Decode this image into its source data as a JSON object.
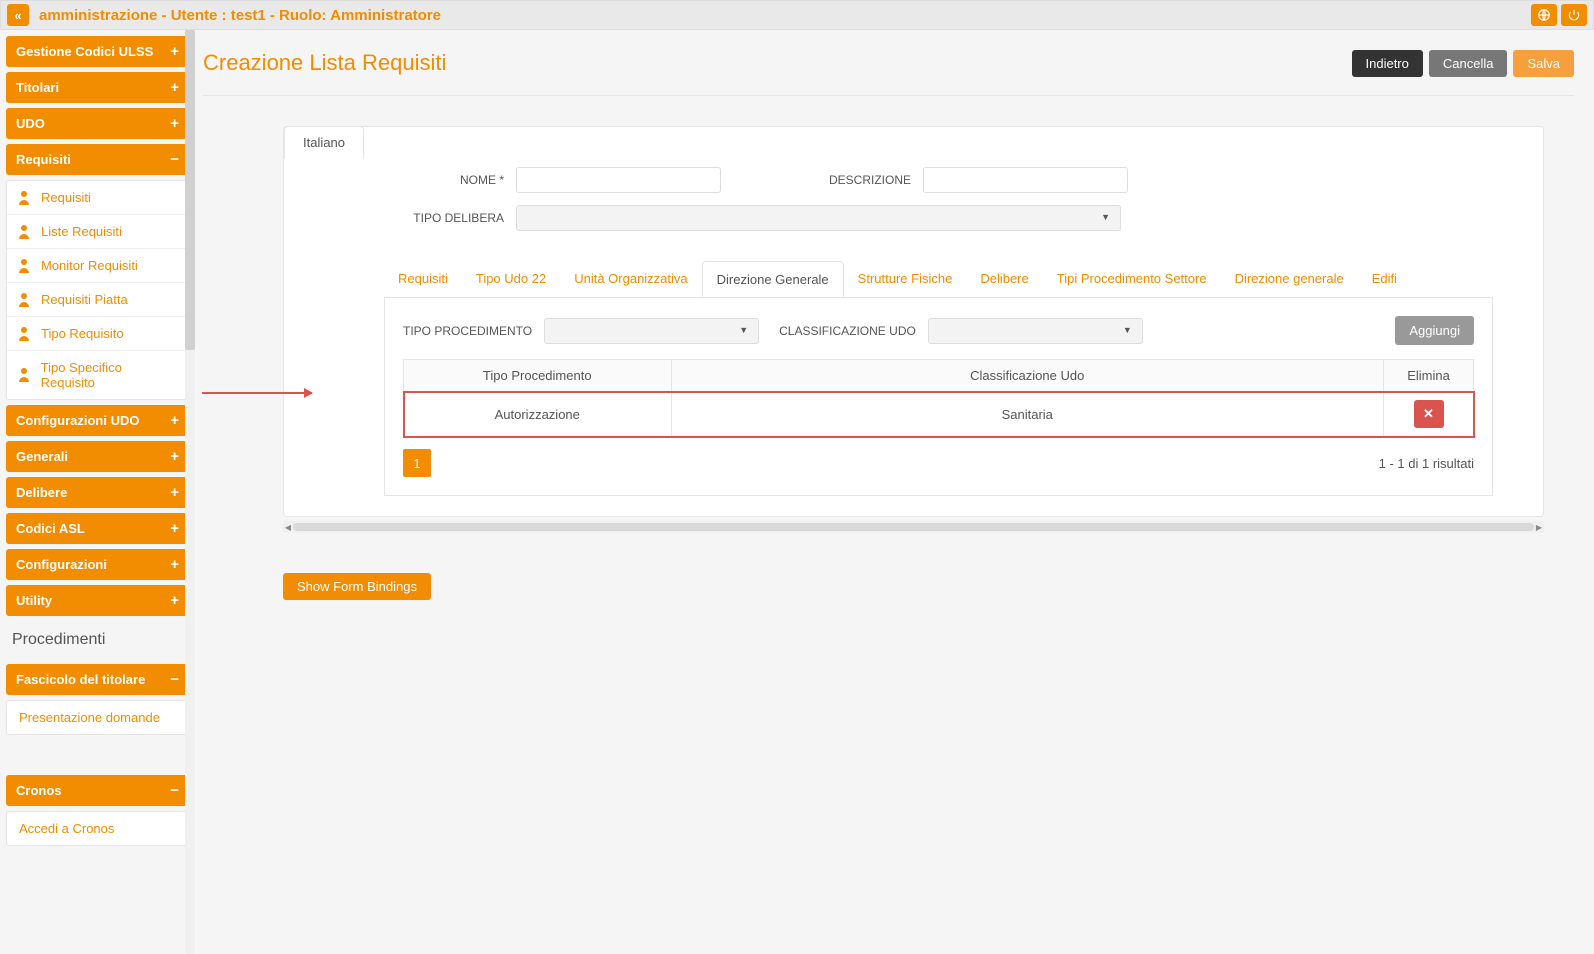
{
  "topbar": {
    "title": "amministrazione - Utente : test1 - Ruolo: Amministratore"
  },
  "sidebar": {
    "sections": [
      {
        "label": "Gestione Codici ULSS",
        "toggle": "+"
      },
      {
        "label": "Titolari",
        "toggle": "+"
      },
      {
        "label": "UDO",
        "toggle": "+"
      },
      {
        "label": "Requisiti",
        "toggle": "−",
        "items": [
          {
            "label": "Requisiti"
          },
          {
            "label": "Liste Requisiti"
          },
          {
            "label": "Monitor Requisiti"
          },
          {
            "label": "Requisiti Piatta"
          },
          {
            "label": "Tipo Requisito"
          },
          {
            "label": "Tipo Specifico Requisito"
          }
        ]
      },
      {
        "label": "Configurazioni UDO",
        "toggle": "+"
      },
      {
        "label": "Generali",
        "toggle": "+"
      },
      {
        "label": "Delibere",
        "toggle": "+"
      },
      {
        "label": "Codici ASL",
        "toggle": "+"
      },
      {
        "label": "Configurazioni",
        "toggle": "+"
      },
      {
        "label": "Utility",
        "toggle": "+"
      }
    ],
    "plain_title": "Procedimenti",
    "fascicolo": {
      "label": "Fascicolo del titolare",
      "toggle": "−",
      "items": [
        {
          "label": "Presentazione domande"
        }
      ]
    },
    "cronos": {
      "label": "Cronos",
      "toggle": "−",
      "items": [
        {
          "label": "Accedi a Cronos"
        }
      ]
    }
  },
  "page": {
    "title": "Creazione Lista Requisiti",
    "buttons": {
      "back": "Indietro",
      "cancel": "Cancella",
      "save": "Salva"
    }
  },
  "form": {
    "lang_tab": "Italiano",
    "labels": {
      "nome": "NOME *",
      "descrizione": "DESCRIZIONE",
      "tipo_delibera": "TIPO DELIBERA"
    },
    "values": {
      "nome": "",
      "descrizione": "",
      "tipo_delibera": ""
    }
  },
  "tabs": [
    {
      "label": "Requisiti"
    },
    {
      "label": "Tipo Udo 22"
    },
    {
      "label": "Unità Organizzativa"
    },
    {
      "label": "Direzione Generale",
      "active": true
    },
    {
      "label": "Strutture Fisiche"
    },
    {
      "label": "Delibere"
    },
    {
      "label": "Tipi Procedimento Settore"
    },
    {
      "label": "Direzione generale"
    },
    {
      "label": "Edifi"
    }
  ],
  "filters": {
    "tipo_procedimento_label": "TIPO PROCEDIMENTO",
    "classificazione_udo_label": "CLASSIFICAZIONE UDO",
    "add_button": "Aggiungi"
  },
  "table": {
    "headers": {
      "tipo": "Tipo Procedimento",
      "classificazione": "Classificazione Udo",
      "elimina": "Elimina"
    },
    "rows": [
      {
        "tipo": "Autorizzazione",
        "classificazione": "Sanitaria"
      }
    ]
  },
  "pagination": {
    "current": "1",
    "summary": "1 - 1 di 1 risultati"
  },
  "footer_button": "Show Form Bindings"
}
